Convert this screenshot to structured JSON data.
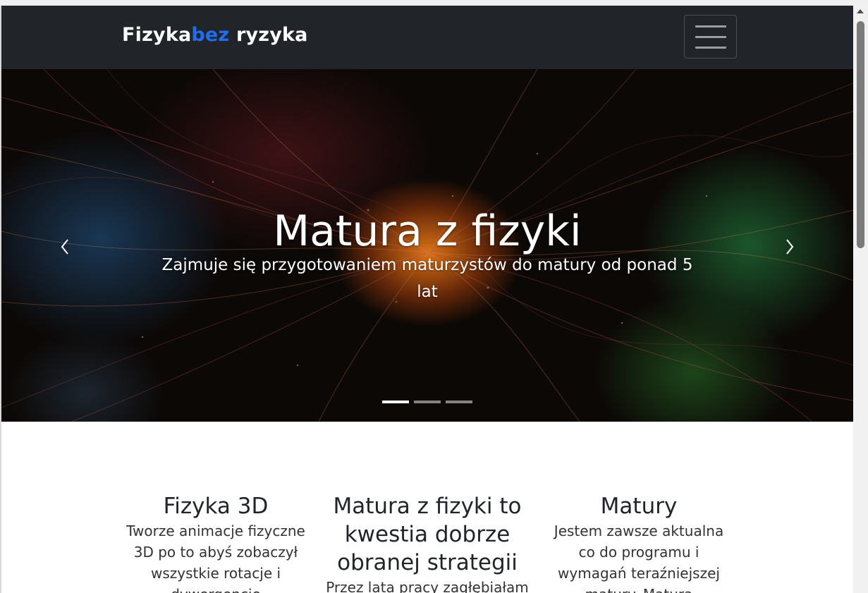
{
  "navbar": {
    "brand_main": "Fizyka",
    "brand_accent": "bez",
    "brand_end": " ryzyka",
    "toggler_icon": "hamburger-icon"
  },
  "colors": {
    "navbar_bg": "#212529",
    "brand_accent": "#1e6ff0"
  },
  "hero": {
    "title": "Matura z fizyki",
    "subtitle": "Zajmuje się przygotowaniem maturzystów do matury od ponad 5 lat",
    "prev_icon": "chevron-left-icon",
    "next_icon": "chevron-right-icon",
    "slides_count": 3,
    "active_slide": 1
  },
  "features": [
    {
      "title": "Fizyka 3D",
      "text": "Tworze animacje fizyczne 3D po to abyś zobaczył wszystkie rotacje i dywergencje"
    },
    {
      "title": "Matura z fizyki to kwestia dobrze obranej strategii",
      "text": "Przez lata pracy zagłębiałam"
    },
    {
      "title": "Matury",
      "text": "Jestem zawsze aktualna co do programu i wymagań teraźniejszej matury. Maturą"
    }
  ]
}
